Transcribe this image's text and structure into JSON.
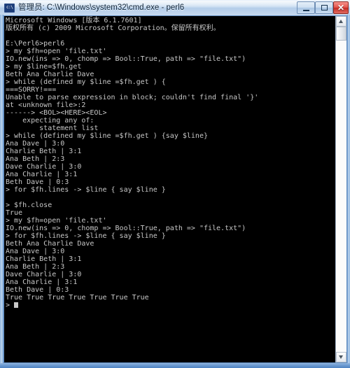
{
  "window": {
    "title": "管理员: C:\\Windows\\system32\\cmd.exe - perl6",
    "icon_glyph": "c:\\",
    "icon_name": "cmd-console-icon",
    "buttons": {
      "minimize_label": "–",
      "maximize_label": "□",
      "close_label": "✕"
    },
    "colors": {
      "console_background": "#000000",
      "console_foreground": "#c8c8c8",
      "frame_accent": "#7ba7d8",
      "close_button": "#c32a22"
    }
  },
  "scrollbar": {
    "up_arrow_label": "▲",
    "down_arrow_label": "▼"
  },
  "console": {
    "lines": [
      "Microsoft Windows [版本 6.1.7601]",
      "版权所有 (c) 2009 Microsoft Corporation。保留所有权利。",
      "",
      "E:\\Perl6>perl6",
      "> my $fh=open 'file.txt'",
      "IO.new(ins => 0, chomp => Bool::True, path => \"file.txt\")",
      "> my $line=$fh.get",
      "Beth Ana Charlie Dave",
      "> while (defined my $line =$fh.get ) {",
      "===SORRY!===",
      "Unable to parse expression in block; couldn't find final '}'",
      "at <unknown file>:2",
      "------> <BOL><HERE><EOL>",
      "    expecting any of:",
      "        statement list",
      "> while (defined my $line =$fh.get ) {say $line}",
      "Ana Dave | 3:0",
      "Charlie Beth | 3:1",
      "Ana Beth | 2:3",
      "Dave Charlie | 3:0",
      "Ana Charlie | 3:1",
      "Beth Dave | 0:3",
      "> for $fh.lines -> $line { say $line }",
      "",
      "> $fh.close",
      "True",
      "> my $fh=open 'file.txt'",
      "IO.new(ins => 0, chomp => Bool::True, path => \"file.txt\")",
      "> for $fh.lines -> $line { say $line }",
      "Beth Ana Charlie Dave",
      "Ana Dave | 3:0",
      "Charlie Beth | 3:1",
      "Ana Beth | 2:3",
      "Dave Charlie | 3:0",
      "Ana Charlie | 3:1",
      "Beth Dave | 0:3",
      "True True True True True True True"
    ],
    "prompt": ">"
  }
}
